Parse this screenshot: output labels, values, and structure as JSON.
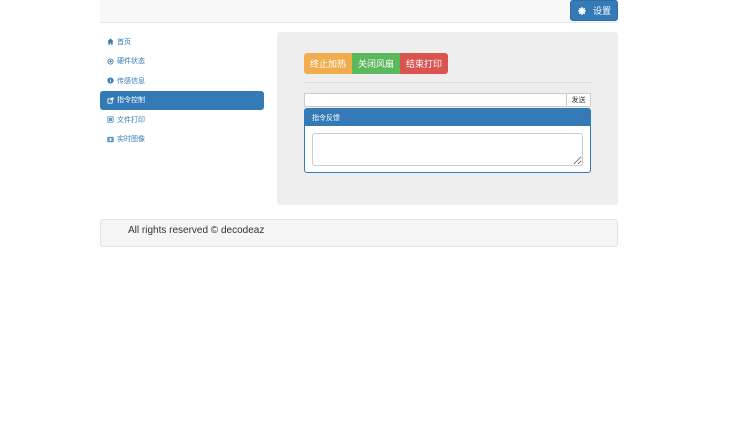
{
  "header": {
    "settings_label": "设置",
    "settings_icon": "gear-icon"
  },
  "sidebar": {
    "items": [
      {
        "label": "首页",
        "icon": "home-icon"
      },
      {
        "label": "硬件状态",
        "icon": "circle-arrow-icon"
      },
      {
        "label": "传感信息",
        "icon": "info-icon"
      },
      {
        "label": "指令控制",
        "icon": "share-icon",
        "active": true
      },
      {
        "label": "文件打印",
        "icon": "list-icon"
      },
      {
        "label": "实时图像",
        "icon": "film-icon"
      }
    ]
  },
  "main": {
    "buttons": {
      "stop_heat": "终止加热",
      "fan_off": "关闭风扇",
      "end_print": "结束打印"
    },
    "command": {
      "input_value": "",
      "send_label": "发送"
    },
    "feedback_panel": {
      "title": "指令反馈",
      "value": ""
    }
  },
  "footer": {
    "text": "All rights reserved © decodeaz"
  },
  "colors": {
    "primary": "#337ab7",
    "warning": "#f0ad4e",
    "success": "#5cb85c",
    "danger": "#d9534f"
  }
}
